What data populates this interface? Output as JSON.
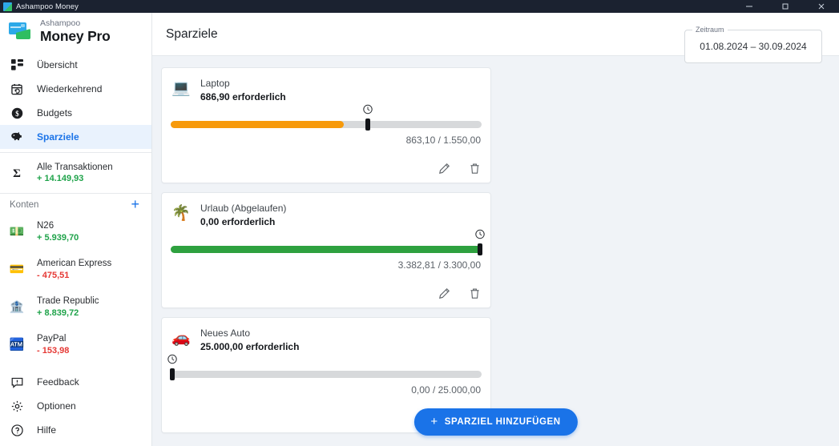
{
  "window": {
    "title": "Ashampoo Money",
    "app_icon": "app-logo-icon",
    "minimize": "−",
    "maximize": "▢",
    "close": "✕"
  },
  "sidebar": {
    "brand": {
      "sub": "Ashampoo",
      "main": "Money Pro"
    },
    "nav": [
      {
        "label": "Übersicht",
        "icon": "dashboard-icon",
        "active": false
      },
      {
        "label": "Wiederkehrend",
        "icon": "calendar-repeat-icon",
        "active": false
      },
      {
        "label": "Budgets",
        "icon": "dollar-coin-icon",
        "active": false
      },
      {
        "label": "Sparziele",
        "icon": "piggy-bank-icon",
        "active": true
      }
    ],
    "transactions": {
      "label": "Alle Transaktionen",
      "amount": "+ 14.149,93",
      "icon": "sigma-icon"
    },
    "accounts_header": {
      "label": "Konten",
      "add_icon": "plus-icon"
    },
    "accounts": [
      {
        "name": "N26",
        "amount": "+ 5.939,70",
        "positive": true,
        "icon": "money-bills-icon"
      },
      {
        "name": "American Express",
        "amount": "- 475,51",
        "positive": false,
        "icon": "credit-card-icon"
      },
      {
        "name": "Trade Republic",
        "amount": "+ 8.839,72",
        "positive": true,
        "icon": "bank-icon"
      },
      {
        "name": "PayPal",
        "amount": "- 153,98",
        "positive": false,
        "icon": "paypal-icon"
      }
    ],
    "bottom": [
      {
        "label": "Feedback",
        "icon": "feedback-icon"
      },
      {
        "label": "Optionen",
        "icon": "gear-icon"
      },
      {
        "label": "Hilfe",
        "icon": "help-circle-icon"
      }
    ]
  },
  "header": {
    "title": "Sparziele",
    "date_range": {
      "legend": "Zeitraum",
      "value": "01.08.2024 – 30.09.2024"
    }
  },
  "goals": [
    {
      "name": "Laptop",
      "required": "686,90 erforderlich",
      "emoji": "💻",
      "emoji_name": "laptop-emoji",
      "amounts": "863,10 / 1.550,00",
      "progress_percent": 55.7,
      "marker_percent": 63.3,
      "fill_color": "#f79a0b",
      "edit_icon": "pencil-icon",
      "delete_icon": "trash-icon"
    },
    {
      "name": "Urlaub (Abgelaufen)",
      "required": "0,00 erforderlich",
      "emoji": "🌴",
      "emoji_name": "palm-tree-emoji",
      "amounts": "3.382,81 / 3.300,00",
      "progress_percent": 100,
      "marker_percent": 99.5,
      "fill_color": "#2ea13f",
      "edit_icon": "pencil-icon",
      "delete_icon": "trash-icon"
    },
    {
      "name": "Neues Auto",
      "required": "25.000,00 erforderlich",
      "emoji": "🚗",
      "emoji_name": "car-emoji",
      "amounts": "0,00 / 25.000,00",
      "progress_percent": 0,
      "marker_percent": 0.4,
      "fill_color": "#2ea13f",
      "edit_icon": "pencil-icon",
      "delete_icon": "trash-icon"
    }
  ],
  "add_button": {
    "label": "SPARZIEL HINZUFÜGEN",
    "plus": "+"
  },
  "colors": {
    "accent": "#1a73e8",
    "positive": "#1fa34a",
    "negative": "#e53935",
    "bar_track": "#d7d9db",
    "orange": "#f79a0b",
    "green": "#2ea13f",
    "main_bg": "#f0f3f7",
    "titlebar_bg": "#1b2230"
  }
}
